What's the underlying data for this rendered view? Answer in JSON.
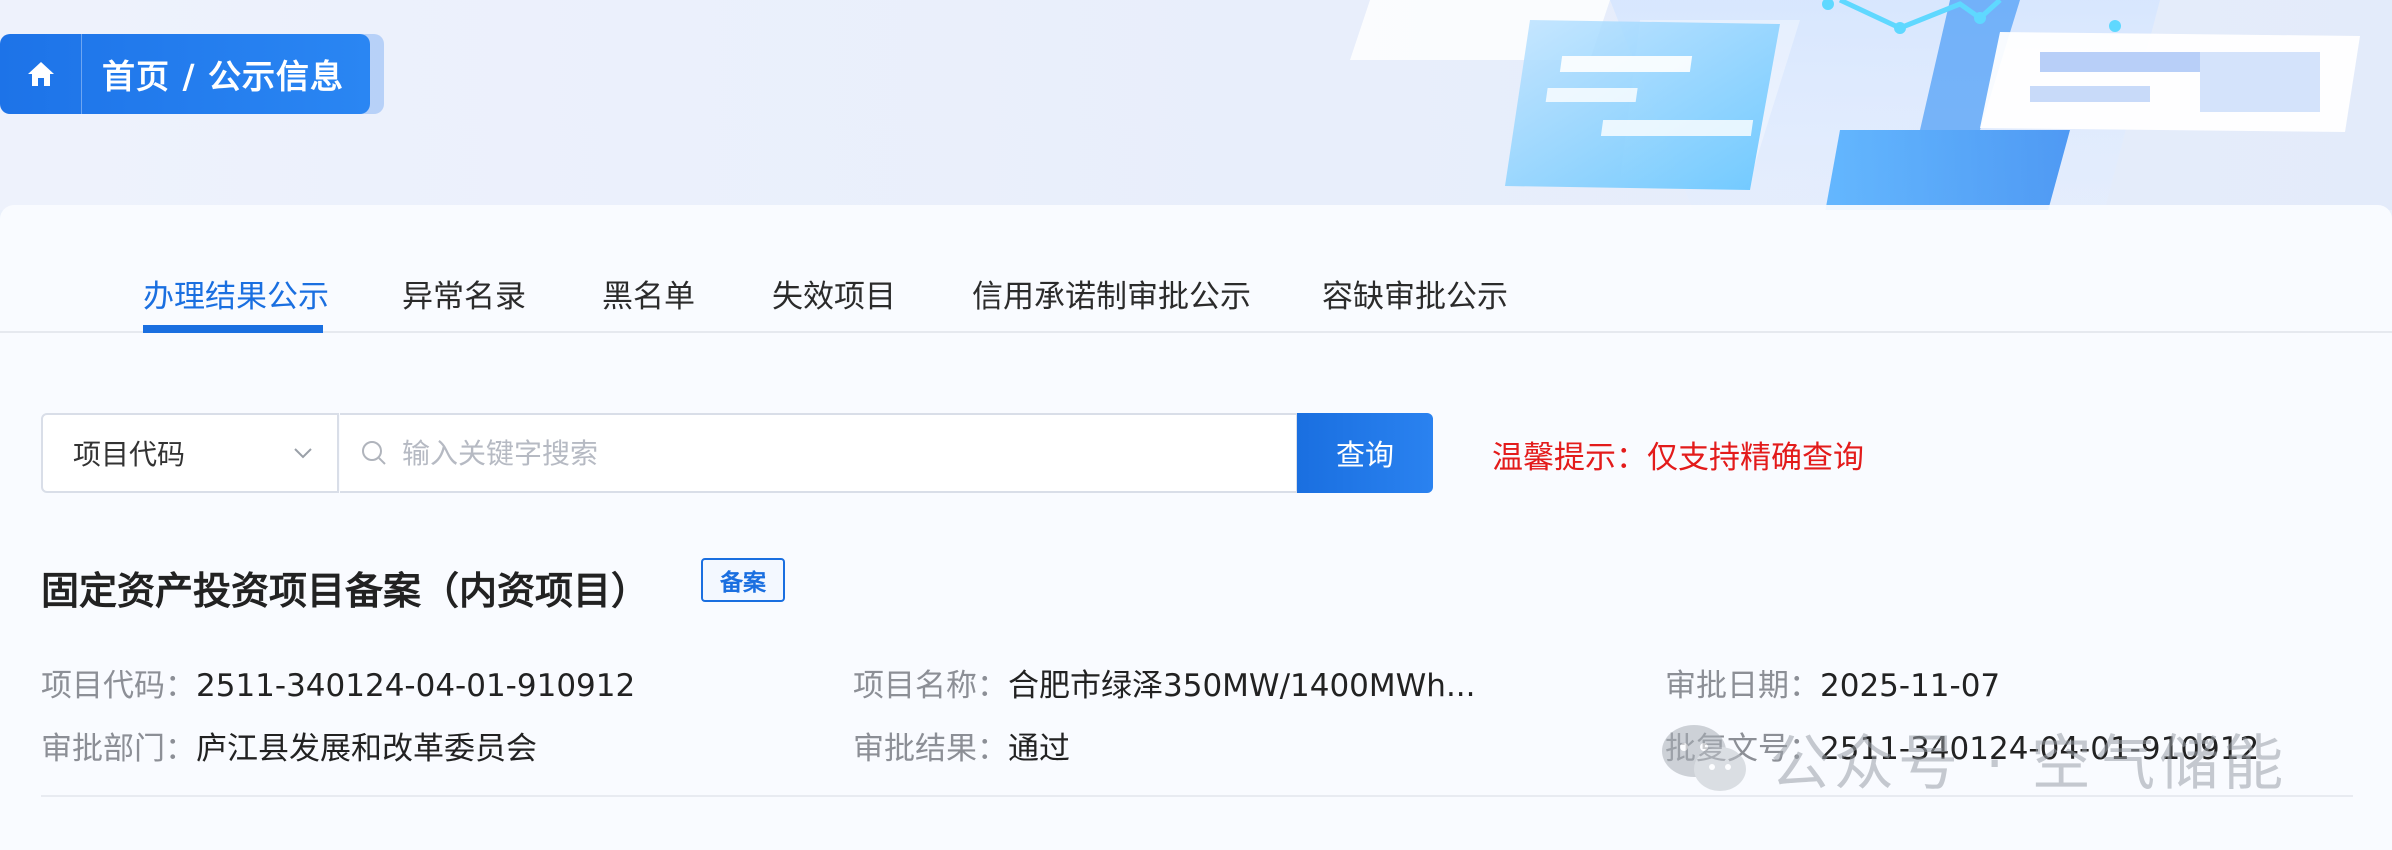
{
  "breadcrumb": {
    "text": "首页 / 公示信息",
    "icon": "home-icon"
  },
  "tabs": [
    {
      "label": "办理结果公示",
      "active": true
    },
    {
      "label": "异常名录"
    },
    {
      "label": "黑名单"
    },
    {
      "label": "失效项目"
    },
    {
      "label": "信用承诺制审批公示"
    },
    {
      "label": "容缺审批公示"
    }
  ],
  "search": {
    "select_value": "项目代码",
    "placeholder": "输入关键字搜索",
    "button_label": "查询",
    "tip": "温馨提示：仅支持精确查询"
  },
  "result": {
    "title": "固定资产投资项目备案（内资项目）",
    "badge": "备案",
    "fields": {
      "project_code": {
        "label": "项目代码：",
        "value": "2511-340124-04-01-910912"
      },
      "project_name": {
        "label": "项目名称：",
        "value": "合肥市绿泽350MW/1400MWh..."
      },
      "approval_date": {
        "label": "审批日期：",
        "value": "2025-11-07"
      },
      "department": {
        "label": "审批部门：",
        "value": "庐江县发展和改革委员会"
      },
      "approval_result": {
        "label": "审批结果：",
        "value": "通过"
      },
      "approval_doc": {
        "label": "批复文号：",
        "value": "2511-340124-04-01-910912"
      }
    }
  },
  "watermark": "公众号 · 空气储能",
  "colors": {
    "accent": "#1a6fe0",
    "tip": "#e31b1b"
  }
}
